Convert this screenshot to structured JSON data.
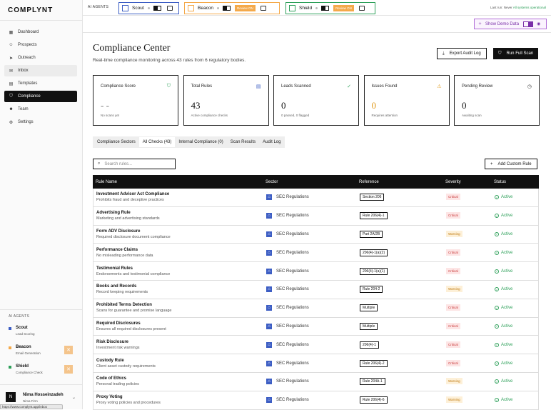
{
  "app": {
    "logo": "COMPLYNT"
  },
  "sidebar": {
    "items": [
      {
        "label": "Dashboard",
        "icon": "dashboard-icon",
        "glyph": "▦"
      },
      {
        "label": "Prospects",
        "icon": "users-icon",
        "glyph": "☺"
      },
      {
        "label": "Outreach",
        "icon": "send-icon",
        "glyph": "➤"
      },
      {
        "label": "Inbox",
        "icon": "inbox-icon",
        "glyph": "✉"
      },
      {
        "label": "Templates",
        "icon": "file-icon",
        "glyph": "▤"
      },
      {
        "label": "Compliance",
        "icon": "shield-icon",
        "glyph": "⛉"
      },
      {
        "label": "Team",
        "icon": "team-icon",
        "glyph": "☻"
      },
      {
        "label": "Settings",
        "icon": "gear-icon",
        "glyph": "⚙"
      }
    ],
    "agents_title": "AI AGENTS",
    "agents": [
      {
        "name": "Scout",
        "sub": "Lead Scoring",
        "color": "#3d5ec4"
      },
      {
        "name": "Beacon",
        "sub": "Email Generation",
        "color": "#f4a94a"
      },
      {
        "name": "Shield",
        "sub": "Compliance Check",
        "color": "#2ea05a"
      }
    ],
    "user": {
      "initial": "N",
      "name": "Nima Hosseinzadeh",
      "firm": "Nima Firm"
    },
    "url_tooltip": "https://www.complynt.app/inbox"
  },
  "topbar": {
    "label": "AI AGENTS",
    "agents": [
      {
        "name": "Scout",
        "color": "#3d5ec4",
        "review": ""
      },
      {
        "name": "Beacon",
        "color": "#f4a94a",
        "review": "Review ON"
      },
      {
        "name": "Shield",
        "color": "#2ea05a",
        "review": "Review ON"
      }
    ],
    "last_run_prefix": "Last run: Never",
    "last_run_status": "All systems operational"
  },
  "demo": {
    "label": "Show Demo Data"
  },
  "page": {
    "title": "Compliance Center",
    "subtitle": "Real-time compliance monitoring across 43 rules from 6 regulatory bodies.",
    "export_label": "Export Audit Log",
    "scan_label": "Run Full Scan"
  },
  "cards": [
    {
      "label": "Compliance Score",
      "value": "- -",
      "sub": "No scans yet",
      "icon": "shield-check-icon",
      "glyph": "⛉",
      "icon_color": "#2ea05a",
      "value_color": "#777"
    },
    {
      "label": "Total Rules",
      "value": "43",
      "sub": "Active compliance checks",
      "icon": "document-icon",
      "glyph": "▤",
      "icon_color": "#3d5ec4",
      "value_color": "#111"
    },
    {
      "label": "Leads Scanned",
      "value": "0",
      "sub": "0 passed, 0 flagged",
      "icon": "check-circle-icon",
      "glyph": "✓",
      "icon_color": "#2ea05a",
      "value_color": "#111"
    },
    {
      "label": "Issues Found",
      "value": "0",
      "sub": "Requires attention",
      "icon": "warning-icon",
      "glyph": "⚠",
      "icon_color": "#e09a1c",
      "value_color": "#e09a1c"
    },
    {
      "label": "Pending Review",
      "value": "0",
      "sub": "Awaiting scan",
      "icon": "clock-icon",
      "glyph": "◷",
      "icon_color": "#333",
      "value_color": "#111"
    }
  ],
  "tabs": [
    "Compliance Sectors",
    "All Checks (43)",
    "Internal Compliance (0)",
    "Scan Results",
    "Audit Log"
  ],
  "search": {
    "placeholder": "Search rules..."
  },
  "add_rule_label": "Add Custom Rule",
  "table": {
    "headers": [
      "Rule Name",
      "Sector",
      "Reference",
      "Severity",
      "Status"
    ],
    "rows": [
      {
        "name": "Investment Advisor Act Compliance",
        "desc": "Prohibits fraud and deceptive practices",
        "sector": "SEC Regulations",
        "ref": "Section 206",
        "severity": "Critical",
        "status": "Active"
      },
      {
        "name": "Advertising Rule",
        "desc": "Marketing and advertising standards",
        "sector": "SEC Regulations",
        "ref": "Rule 206(4)-1",
        "severity": "Critical",
        "status": "Active"
      },
      {
        "name": "Form ADV Disclosure",
        "desc": "Required disclosure document compliance",
        "sector": "SEC Regulations",
        "ref": "Part 2A/2B",
        "severity": "Warning",
        "status": "Active"
      },
      {
        "name": "Performance Claims",
        "desc": "No misleading performance data",
        "sector": "SEC Regulations",
        "ref": "206(4)-1(a)(2)",
        "severity": "Critical",
        "status": "Active"
      },
      {
        "name": "Testimonial Rules",
        "desc": "Endorsements and testimonial compliance",
        "sector": "SEC Regulations",
        "ref": "206(4)-1(a)(1)",
        "severity": "Critical",
        "status": "Active"
      },
      {
        "name": "Books and Records",
        "desc": "Record keeping requirements",
        "sector": "SEC Regulations",
        "ref": "Rule 204-2",
        "severity": "Warning",
        "status": "Active"
      },
      {
        "name": "Prohibited Terms Detection",
        "desc": "Scans for guarantee and promise language",
        "sector": "SEC Regulations",
        "ref": "Multiple",
        "severity": "Critical",
        "status": "Active"
      },
      {
        "name": "Required Disclosures",
        "desc": "Ensures all required disclosures present",
        "sector": "SEC Regulations",
        "ref": "Multiple",
        "severity": "Critical",
        "status": "Active"
      },
      {
        "name": "Risk Disclosure",
        "desc": "Investment risk warnings",
        "sector": "SEC Regulations",
        "ref": "206(4)-1",
        "severity": "Critical",
        "status": "Active"
      },
      {
        "name": "Custody Rule",
        "desc": "Client asset custody requirements",
        "sector": "SEC Regulations",
        "ref": "Rule 206(4)-2",
        "severity": "Critical",
        "status": "Active"
      },
      {
        "name": "Code of Ethics",
        "desc": "Personal trading policies",
        "sector": "SEC Regulations",
        "ref": "Rule 204A-1",
        "severity": "Warning",
        "status": "Active"
      },
      {
        "name": "Proxy Voting",
        "desc": "Proxy voting policies and procedures",
        "sector": "SEC Regulations",
        "ref": "Rule 206(4)-6",
        "severity": "Warning",
        "status": "Active"
      }
    ]
  }
}
